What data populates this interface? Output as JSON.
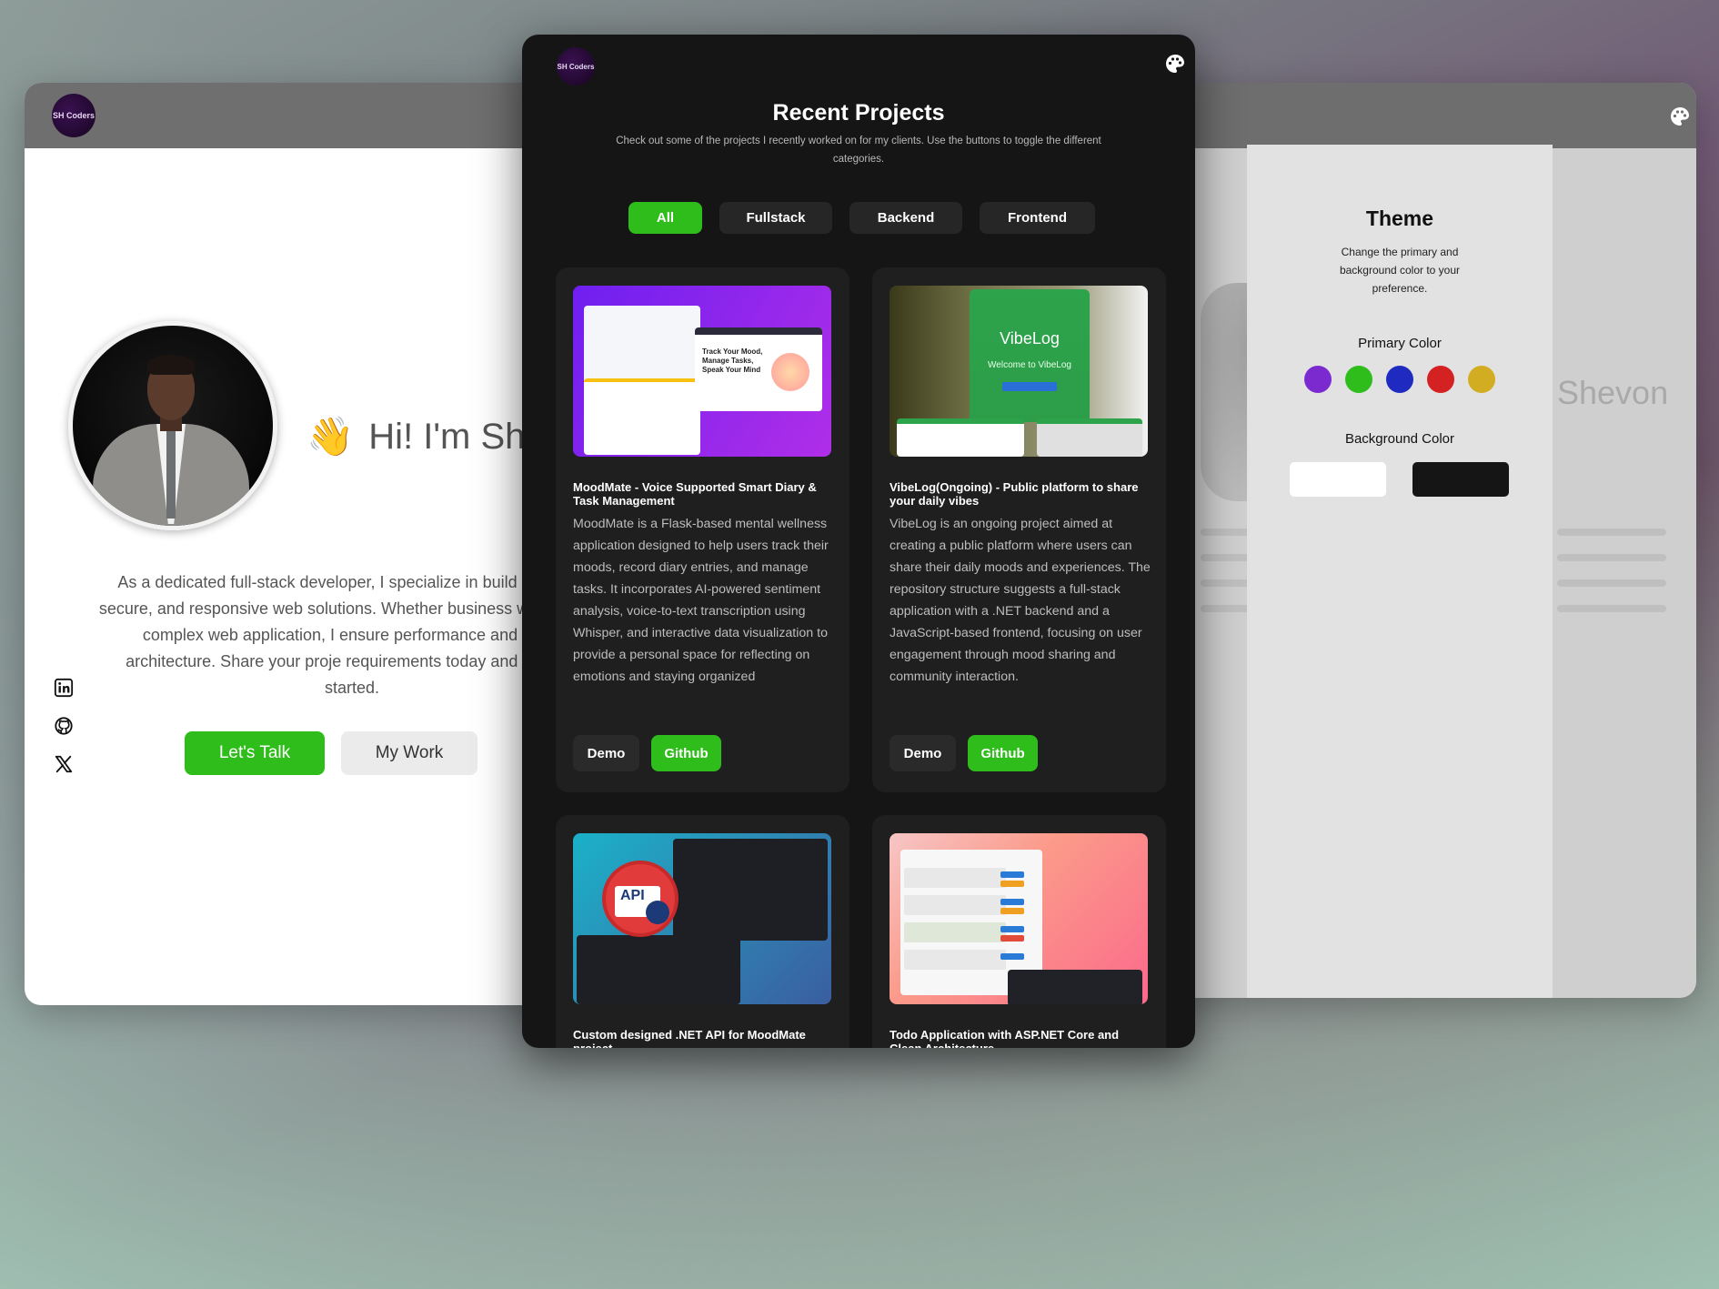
{
  "left_window": {
    "logo_text": "SH Coders",
    "greeting_emoji": "👋",
    "greeting_text": "Hi! I'm She",
    "intro": "As a dedicated full-stack developer, I specialize in build scalable, secure, and responsive web solutions. Whether business website or a complex web application, I ensure performance and clean architecture. Share your proje requirements today and let's get started.",
    "cta_primary": "Let's Talk",
    "cta_secondary": "My Work",
    "social_icons": [
      "linkedin-icon",
      "github-icon",
      "x-icon"
    ]
  },
  "center_window": {
    "logo_text": "SH Coders",
    "title": "Recent Projects",
    "subtitle": "Check out some of the projects I recently worked on for my clients. Use the buttons to toggle the different categories.",
    "filters": [
      {
        "label": "All",
        "active": true
      },
      {
        "label": "Fullstack",
        "active": false
      },
      {
        "label": "Backend",
        "active": false
      },
      {
        "label": "Frontend",
        "active": false
      }
    ],
    "projects": [
      {
        "title": "MoodMate - Voice Supported Smart Diary & Task Management",
        "description": "MoodMate is a Flask-based mental wellness application designed to help users track their moods, record diary entries, and manage tasks. It incorporates AI-powered sentiment analysis, voice-to-text transcription using Whisper, and interactive data visualization to provide a personal space for reflecting on emotions and staying organized",
        "thumb_caption": "Track Your Mood, Manage Tasks, Speak Your Mind",
        "demo_label": "Demo",
        "github_label": "Github"
      },
      {
        "title": "VibeLog(Ongoing) - Public platform to share your daily vibes",
        "description": "VibeLog is an ongoing project aimed at creating a public platform where users can share their daily moods and experiences. The repository structure suggests a full-stack application with a .NET backend and a JavaScript-based frontend, focusing on user engagement through mood sharing and community interaction.",
        "thumb_caption": "VibeLog",
        "thumb_sub": "Welcome to VibeLog",
        "demo_label": "Demo",
        "github_label": "Github"
      },
      {
        "title": "Custom designed .NET API for MoodMate project",
        "thumb_caption": "API"
      },
      {
        "title": "Todo Application with ASP.NET Core and Clean Architecture"
      }
    ]
  },
  "right_window": {
    "ghost_name": "Shevon",
    "theme": {
      "title": "Theme",
      "description": "Change the primary and background color to your preference.",
      "primary_label": "Primary Color",
      "background_label": "Background Color",
      "primary_colors": [
        "#7b2ad0",
        "#2fbd1c",
        "#1f2bc0",
        "#d42121",
        "#d2ad22"
      ],
      "background_colors": [
        "#ffffff",
        "#151515"
      ]
    }
  },
  "colors": {
    "accent": "#2fbd1c",
    "dark_bg": "#151515",
    "card_bg": "#1f1f1f"
  }
}
